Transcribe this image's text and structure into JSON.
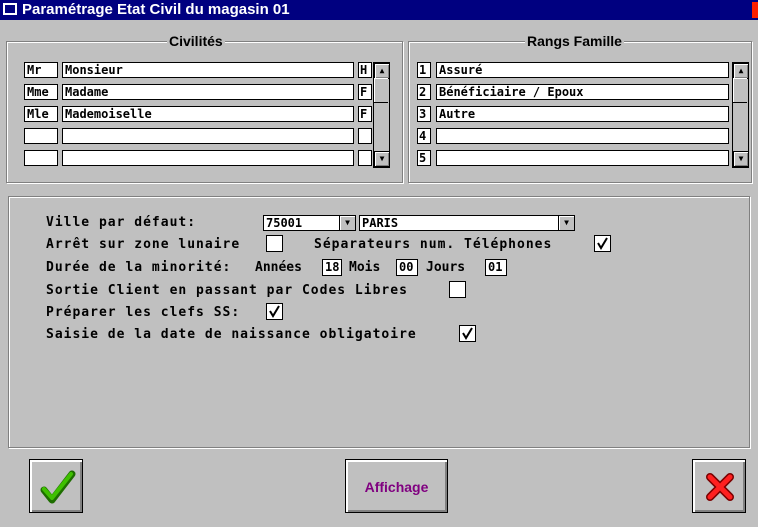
{
  "window": {
    "title": "Paramétrage Etat Civil du magasin 01"
  },
  "civilites": {
    "legend": "Civilités",
    "rows": [
      {
        "code": "Mr",
        "label": "Monsieur",
        "sex": "H"
      },
      {
        "code": "Mme",
        "label": "Madame",
        "sex": "F"
      },
      {
        "code": "Mle",
        "label": "Mademoiselle",
        "sex": "F"
      },
      {
        "code": "",
        "label": "",
        "sex": ""
      },
      {
        "code": "",
        "label": "",
        "sex": ""
      }
    ]
  },
  "rangs": {
    "legend": "Rangs Famille",
    "rows": [
      {
        "num": "1",
        "label": "Assuré"
      },
      {
        "num": "2",
        "label": "Bénéficiaire / Epoux"
      },
      {
        "num": "3",
        "label": "Autre"
      },
      {
        "num": "4",
        "label": ""
      },
      {
        "num": "5",
        "label": ""
      }
    ]
  },
  "settings": {
    "ville_label": "Ville par défaut:",
    "ville_code": "75001",
    "ville_name": "PARIS",
    "arret_label": "Arrêt sur zone lunaire",
    "arret_checked": false,
    "separateurs_label": "Séparateurs num. Téléphones",
    "separateurs_checked": true,
    "minorite_label": "Durée de la minorité:",
    "annees_label": "Années",
    "annees_value": "18",
    "mois_label": "Mois",
    "mois_value": "00",
    "jours_label": "Jours",
    "jours_value": "01",
    "sortie_label": "Sortie Client en passant par Codes Libres",
    "sortie_checked": false,
    "clefs_label": "Préparer les clefs SS:",
    "clefs_checked": true,
    "naissance_label": "Saisie de la date de naissance obligatoire",
    "naissance_checked": true
  },
  "buttons": {
    "affichage_label": "Affichage"
  },
  "colors": {
    "title_bar": "#000080",
    "ok": "#2aa000",
    "cancel": "#e01010",
    "affichage_text": "#800080"
  }
}
